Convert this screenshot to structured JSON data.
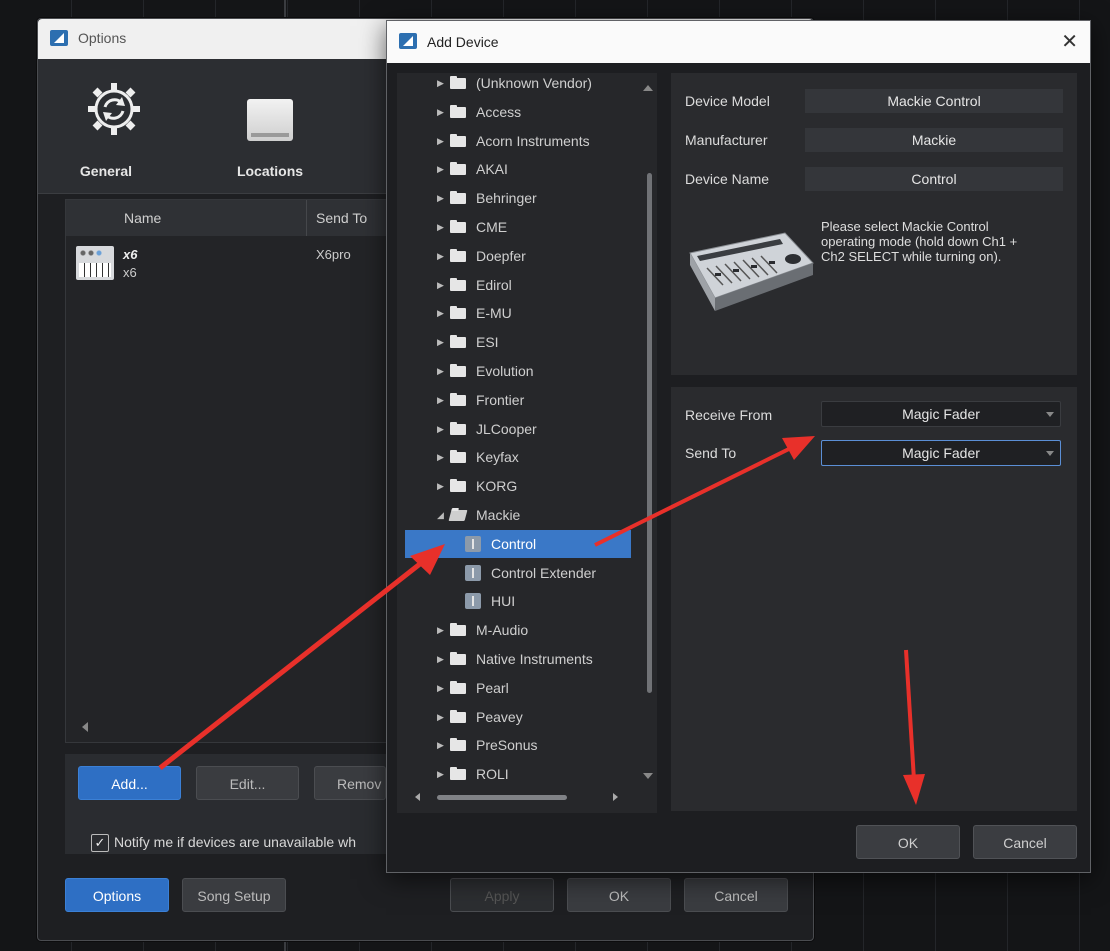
{
  "options_window": {
    "title": "Options",
    "tabs": [
      {
        "label": "General",
        "icon": "gear-refresh-icon"
      },
      {
        "label": "Locations",
        "icon": "disk-icon"
      }
    ],
    "device_table": {
      "headers": {
        "name": "Name",
        "send_to": "Send To"
      },
      "rows": [
        {
          "name": "x6",
          "sub": "x6",
          "send_to": "X6pro",
          "icon": "keyboard-icon"
        }
      ]
    },
    "buttons": {
      "add": "Add...",
      "edit": "Edit...",
      "remove": "Remov"
    },
    "notify": {
      "checked": true,
      "mark": "✓",
      "label": "Notify me if devices are unavailable wh"
    },
    "footer": {
      "options": "Options",
      "song_setup": "Song Setup",
      "apply": "Apply",
      "ok": "OK",
      "cancel": "Cancel"
    }
  },
  "add_device": {
    "title": "Add Device",
    "close_glyph": "✕",
    "tree": {
      "vendors_before": [
        "(Unknown Vendor)",
        "Access",
        "Acorn Instruments",
        "AKAI",
        "Behringer",
        "CME",
        "Doepfer",
        "Edirol",
        "E-MU",
        "ESI",
        "Evolution",
        "Frontier",
        "JLCooper",
        "Keyfax",
        "KORG"
      ],
      "expanded_vendor": "Mackie",
      "children": [
        {
          "label": "Control",
          "selected": true
        },
        {
          "label": "Control Extender",
          "selected": false
        },
        {
          "label": "HUI",
          "selected": false
        }
      ],
      "vendors_after": [
        "M-Audio",
        "Native Instruments",
        "Pearl",
        "Peavey",
        "PreSonus",
        "ROLI"
      ]
    },
    "info": {
      "device_model_label": "Device Model",
      "device_model": "Mackie Control",
      "manufacturer_label": "Manufacturer",
      "manufacturer": "Mackie",
      "device_name_label": "Device Name",
      "device_name": "Control",
      "description": "Please select Mackie Control operating mode (hold down Ch1 + Ch2 SELECT while turning on)."
    },
    "ports": {
      "receive_from_label": "Receive From",
      "receive_from": "Magic Fader",
      "send_to_label": "Send To",
      "send_to": "Magic Fader"
    },
    "buttons": {
      "ok": "OK",
      "cancel": "Cancel"
    }
  },
  "colors": {
    "accent": "#2e6fc4",
    "selection": "#3a78c7",
    "annotation_arrow": "#e8302a"
  }
}
